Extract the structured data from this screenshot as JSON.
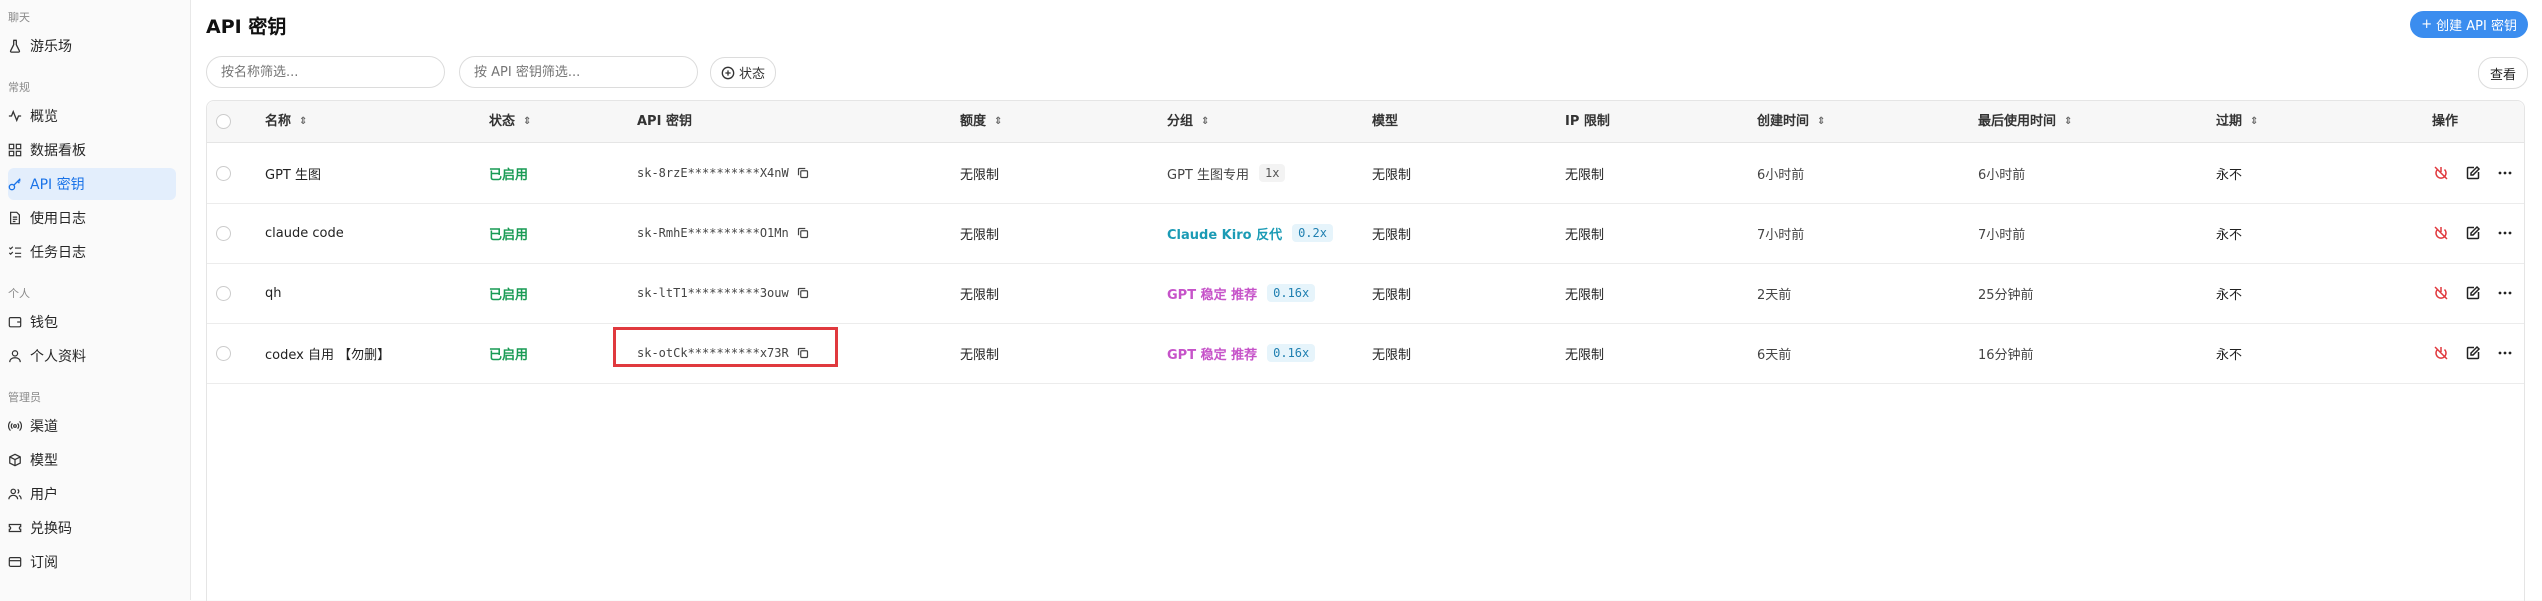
{
  "sidebar": {
    "sections": [
      {
        "title": "聊天",
        "items": [
          {
            "label": "游乐场",
            "icon": "flask-icon"
          }
        ]
      },
      {
        "title": "常规",
        "items": [
          {
            "label": "概览",
            "icon": "activity-icon"
          },
          {
            "label": "数据看板",
            "icon": "dashboard-icon"
          },
          {
            "label": "API 密钥",
            "icon": "key-icon",
            "active": true
          },
          {
            "label": "使用日志",
            "icon": "file-text-icon"
          },
          {
            "label": "任务日志",
            "icon": "list-check-icon"
          }
        ]
      },
      {
        "title": "个人",
        "items": [
          {
            "label": "钱包",
            "icon": "wallet-icon"
          },
          {
            "label": "个人资料",
            "icon": "user-icon"
          }
        ]
      },
      {
        "title": "管理员",
        "items": [
          {
            "label": "渠道",
            "icon": "radio-icon"
          },
          {
            "label": "模型",
            "icon": "box-icon"
          },
          {
            "label": "用户",
            "icon": "users-icon"
          },
          {
            "label": "兑换码",
            "icon": "ticket-icon"
          },
          {
            "label": "订阅",
            "icon": "card-icon"
          }
        ]
      }
    ]
  },
  "page": {
    "title": "API 密钥",
    "create_label": "创建 API 密钥",
    "name_filter_placeholder": "按名称筛选...",
    "key_filter_placeholder": "按 API 密钥筛选...",
    "status_label": "状态",
    "view_label": "查看"
  },
  "table": {
    "headers": {
      "name": "名称",
      "status": "状态",
      "key": "API 密钥",
      "quota": "额度",
      "group": "分组",
      "model": "模型",
      "ip": "IP 限制",
      "created": "创建时间",
      "last_used": "最后使用时间",
      "expires": "过期",
      "actions": "操作"
    },
    "rows": [
      {
        "name": "GPT 生图",
        "status": "已启用",
        "key": "sk-8rzE**********X4nW",
        "quota": "无限制",
        "group": "GPT 生图专用",
        "group_style": "plain",
        "ratio": "1x",
        "ratio_style": "gray",
        "model": "无限制",
        "ip": "无限制",
        "created": "6小时前",
        "last_used": "6小时前",
        "expires": "永不"
      },
      {
        "name": "claude code",
        "status": "已启用",
        "key": "sk-RmhE**********O1Mn",
        "quota": "无限制",
        "group": "Claude Kiro 反代",
        "group_style": "cyan",
        "ratio": "0.2x",
        "ratio_style": "blue",
        "model": "无限制",
        "ip": "无限制",
        "created": "7小时前",
        "last_used": "7小时前",
        "expires": "永不"
      },
      {
        "name": "qh",
        "status": "已启用",
        "key": "sk-ltT1**********3ouw",
        "quota": "无限制",
        "group": "GPT 稳定 推荐",
        "group_style": "purple",
        "ratio": "0.16x",
        "ratio_style": "blue",
        "model": "无限制",
        "ip": "无限制",
        "created": "2天前",
        "last_used": "25分钟前",
        "expires": "永不"
      },
      {
        "name": "codex 自用 【勿删】",
        "status": "已启用",
        "key": "sk-otCk**********x73R",
        "quota": "无限制",
        "group": "GPT 稳定 推荐",
        "group_style": "purple",
        "ratio": "0.16x",
        "ratio_style": "blue",
        "model": "无限制",
        "ip": "无限制",
        "created": "6天前",
        "last_used": "16分钟前",
        "expires": "永不"
      }
    ]
  },
  "colors": {
    "accent": "#3b8def",
    "enabled": "#1a9b55",
    "highlight": "#e0393e",
    "disable_icon": "#e0393e"
  }
}
